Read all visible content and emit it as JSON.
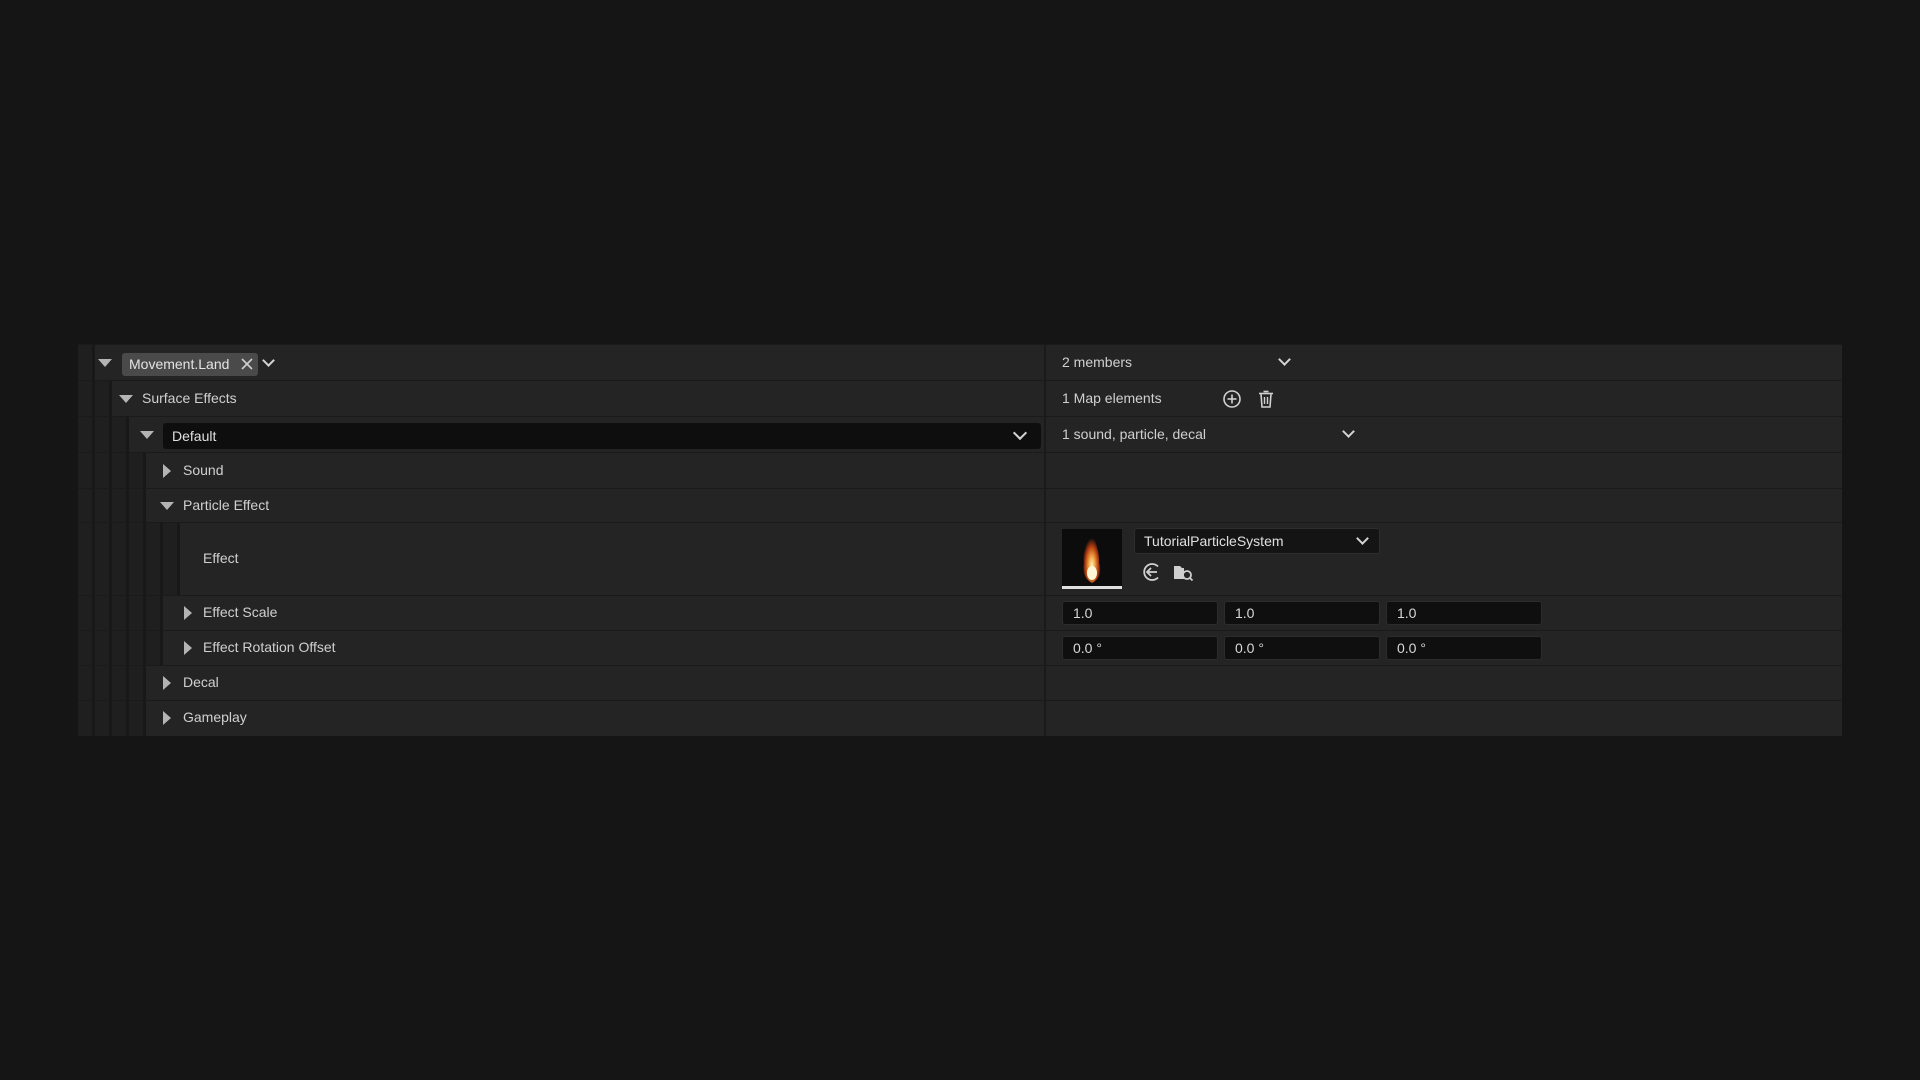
{
  "header": {
    "tag_label": "Movement.Land",
    "members_label": "2 members"
  },
  "surface_effects": {
    "label": "Surface Effects",
    "map_elements_label": "1 Map elements"
  },
  "default_entry": {
    "key_label": "Default",
    "summary_label": "1 sound, particle, decal"
  },
  "rows": {
    "sound": "Sound",
    "particle_effect": "Particle Effect",
    "effect": "Effect",
    "effect_scale": "Effect Scale",
    "effect_rotation_offset": "Effect Rotation Offset",
    "decal": "Decal",
    "gameplay": "Gameplay"
  },
  "effect_asset": {
    "name": "TutorialParticleSystem",
    "thumbnail_icon": "fire-thumbnail"
  },
  "effect_scale_values": [
    "1.0",
    "1.0",
    "1.0"
  ],
  "effect_rotation_values": [
    "0.0 °",
    "0.0 °",
    "0.0 °"
  ],
  "icons": {
    "add": "plus-circle-icon",
    "delete": "trash-icon",
    "use_selected": "arrow-left-circle-icon",
    "browse": "folder-search-icon",
    "clear_tag": "close-icon"
  },
  "colors": {
    "background": "#151515",
    "panel": "#242424",
    "field": "#0f0f0f"
  }
}
